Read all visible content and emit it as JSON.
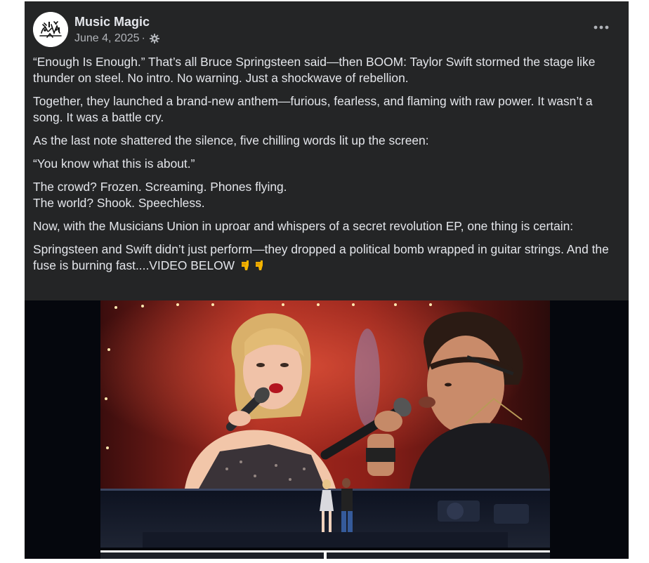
{
  "post": {
    "author": "Music Magic",
    "date": "June 4, 2025",
    "separator": "·",
    "privacy_icon": "gear-icon",
    "more_icon": "more-options-icon",
    "more_label": "•••",
    "paragraphs": [
      "“Enough Is Enough.” That’s all Bruce Springsteen said—then BOOM: Taylor Swift stormed the stage like thunder on steel. No intro. No warning. Just a shockwave of rebellion.",
      "Together, they launched a brand-new anthem—furious, fearless, and flaming with raw power. It wasn’t a song. It was a battle cry.",
      "As the last note shattered the silence, five chilling words lit up the screen:",
      "“You know what this is about.”"
    ],
    "crowd_line": "The crowd? Frozen. Screaming. Phones flying.",
    "world_line": "The world? Shook. Speechless.",
    "paragraph_union": "Now, with the Musicians Union in uproar and whispers of a secret revolution EP, one thing is certain:",
    "paragraph_last": "Springsteen and Swift didn’t just perform—they dropped a political bomb wrapped in guitar strings. And the fuse is burning fast....VIDEO BELOW",
    "emoji_icons": [
      "pointing-down-hand-icon",
      "pointing-down-hand-icon"
    ]
  },
  "colors": {
    "post_background": "#242526",
    "text_primary": "#e4e6eb",
    "text_secondary": "#b0b3b8",
    "media_background": "#05070d"
  }
}
